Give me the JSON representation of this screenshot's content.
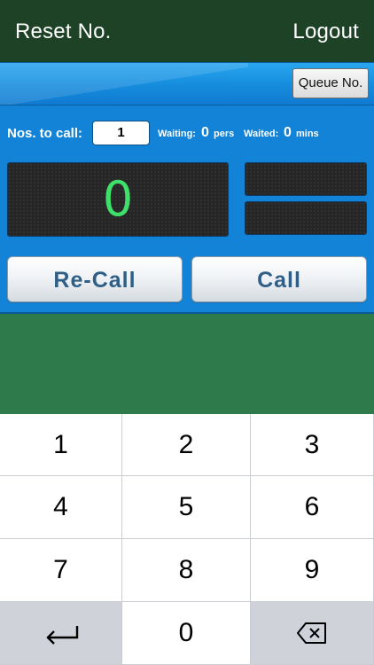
{
  "topbar": {
    "left_label": "Reset No.",
    "right_label": "Logout",
    "bg_color": "#1d4226"
  },
  "panel": {
    "queue_button_label": "Queue No.",
    "nos_to_call_label": "Nos. to call:",
    "nos_to_call_value": "1",
    "waiting_label": "Waiting:",
    "waiting_value": "0",
    "waiting_unit": "pers",
    "waited_label": "Waited:",
    "waited_value": "0",
    "waited_unit": "mins",
    "current_number": "0",
    "display_digit_color": "#3fe06a",
    "recall_label": "Re-Call",
    "call_label": "Call",
    "bg_color": "#1283d6"
  },
  "keypad": {
    "keys": [
      "1",
      "2",
      "3",
      "4",
      "5",
      "6",
      "7",
      "8",
      "9"
    ],
    "zero": "0",
    "left_func_icon": "return-arrow-icon",
    "right_func_icon": "backspace-icon"
  }
}
